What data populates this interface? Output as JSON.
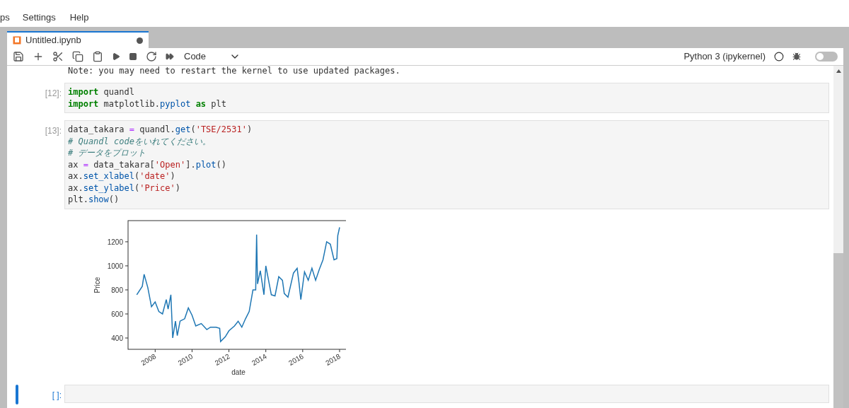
{
  "menu": [
    {
      "label": "ps"
    },
    {
      "label": "Settings"
    },
    {
      "label": "Help"
    }
  ],
  "tab": {
    "title": "Untitled.ipynb",
    "unsaved": true
  },
  "toolbar": {
    "cell_type": "Code",
    "kernel": "Python 3 (ipykernel)",
    "toggle_on": false
  },
  "output_text": "Note: you may need to restart the kernel to use updated packages.",
  "cells": [
    {
      "prompt": "[12]:",
      "selected": false,
      "lines": [
        [
          {
            "text": "import",
            "kind": "keyword"
          },
          {
            "text": " quandl",
            "kind": "name"
          }
        ],
        [
          {
            "text": "import",
            "kind": "keyword"
          },
          {
            "text": " matplotlib.",
            "kind": "name"
          },
          {
            "text": "pyplot",
            "kind": "attr"
          },
          {
            "text": " as",
            "kind": "keyword"
          },
          {
            "text": " plt",
            "kind": "name"
          }
        ]
      ]
    },
    {
      "prompt": "[13]:",
      "selected": false,
      "lines": [
        [
          {
            "text": "data_takara ",
            "kind": "name"
          },
          {
            "text": "=",
            "kind": "op"
          },
          {
            "text": " quandl.",
            "kind": "name"
          },
          {
            "text": "get",
            "kind": "attr"
          },
          {
            "text": "(",
            "kind": "name"
          },
          {
            "text": "'TSE/2531'",
            "kind": "string"
          },
          {
            "text": ")",
            "kind": "name"
          }
        ],
        [
          {
            "text": "# Quandl codeをいれてください。",
            "kind": "comment"
          }
        ],
        [
          {
            "text": "# データをプロット",
            "kind": "comment"
          }
        ],
        [
          {
            "text": "ax ",
            "kind": "name"
          },
          {
            "text": "=",
            "kind": "op"
          },
          {
            "text": " data_takara[",
            "kind": "name"
          },
          {
            "text": "'Open'",
            "kind": "string"
          },
          {
            "text": "].",
            "kind": "name"
          },
          {
            "text": "plot",
            "kind": "attr"
          },
          {
            "text": "()",
            "kind": "name"
          }
        ],
        [
          {
            "text": "ax.",
            "kind": "name"
          },
          {
            "text": "set_xlabel",
            "kind": "attr"
          },
          {
            "text": "(",
            "kind": "name"
          },
          {
            "text": "'date'",
            "kind": "string"
          },
          {
            "text": ")",
            "kind": "name"
          }
        ],
        [
          {
            "text": "ax.",
            "kind": "name"
          },
          {
            "text": "set_ylabel",
            "kind": "attr"
          },
          {
            "text": "(",
            "kind": "name"
          },
          {
            "text": "'Price'",
            "kind": "string"
          },
          {
            "text": ")",
            "kind": "name"
          }
        ],
        [
          {
            "text": "plt.",
            "kind": "name"
          },
          {
            "text": "show",
            "kind": "attr"
          },
          {
            "text": "()",
            "kind": "name"
          }
        ]
      ],
      "chart_data": {
        "type": "line",
        "xlabel": "date",
        "ylabel": "Price",
        "xlim": [
          2006.53,
          2018.5
        ],
        "ylim": [
          306,
          1376
        ],
        "xticks": [
          2008,
          2010,
          2012,
          2014,
          2016,
          2018
        ],
        "yticks": [
          400,
          600,
          800,
          1000,
          1200
        ],
        "x": [
          2007.0,
          2007.3,
          2007.4,
          2007.6,
          2007.8,
          2008.0,
          2008.2,
          2008.4,
          2008.6,
          2008.7,
          2008.85,
          2008.95,
          2009.1,
          2009.2,
          2009.35,
          2009.6,
          2009.8,
          2010.0,
          2010.2,
          2010.5,
          2010.8,
          2011.0,
          2011.3,
          2011.5,
          2011.55,
          2011.8,
          2012.0,
          2012.3,
          2012.5,
          2012.7,
          2012.9,
          2013.1,
          2013.3,
          2013.45,
          2013.5,
          2013.55,
          2013.7,
          2013.9,
          2014.0,
          2014.1,
          2014.3,
          2014.5,
          2014.7,
          2014.9,
          2015.0,
          2015.2,
          2015.5,
          2015.7,
          2015.8,
          2015.9,
          2016.1,
          2016.3,
          2016.5,
          2016.7,
          2016.9,
          2017.1,
          2017.3,
          2017.5,
          2017.7,
          2017.85,
          2017.9,
          2018.0
        ],
        "series": [
          {
            "color": "#1f77b4",
            "values": [
              760,
              830,
              930,
              820,
              660,
              700,
              620,
              600,
              720,
              640,
              760,
              400,
              540,
              420,
              540,
              560,
              650,
              590,
              500,
              520,
              470,
              490,
              490,
              480,
              370,
              410,
              460,
              500,
              540,
              490,
              560,
              620,
              800,
              800,
              1260,
              850,
              960,
              760,
              1000,
              920,
              760,
              750,
              910,
              880,
              770,
              740,
              940,
              980,
              860,
              720,
              950,
              880,
              980,
              880,
              970,
              1050,
              1200,
              1180,
              1050,
              1060,
              1250,
              1320
            ]
          }
        ]
      }
    },
    {
      "prompt": "[ ]:",
      "selected": true
    }
  ]
}
